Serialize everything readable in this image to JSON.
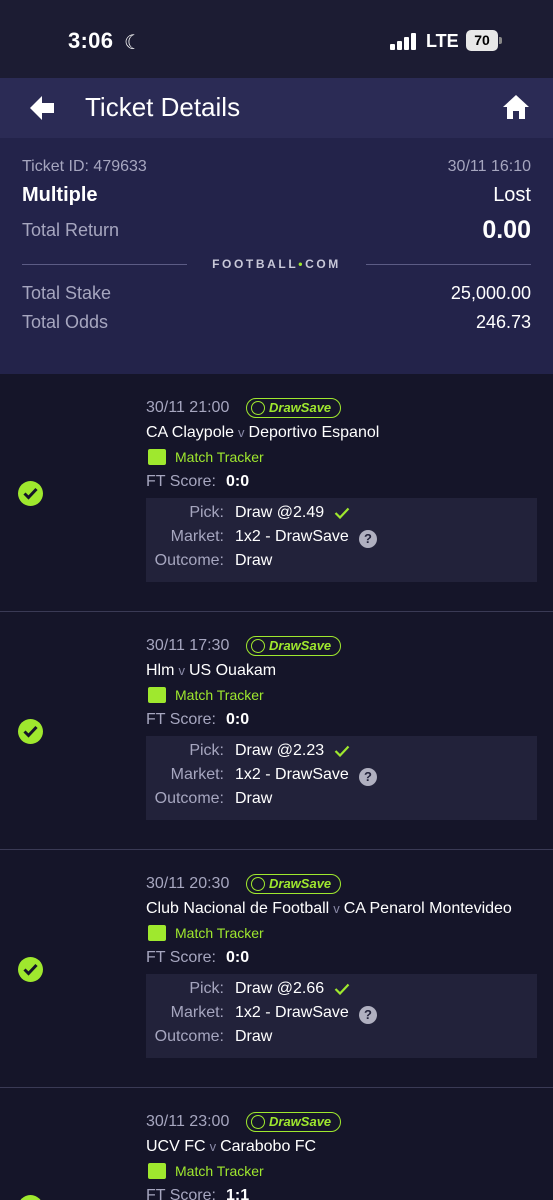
{
  "status_bar": {
    "time": "3:06",
    "network": "LTE",
    "battery": "70"
  },
  "header": {
    "title": "Ticket Details",
    "back_icon": "arrow-left-icon",
    "home_icon": "home-icon"
  },
  "summary": {
    "ticket_id": "Ticket ID: 479633",
    "date": "30/11 16:10",
    "bet_type": "Multiple",
    "status": "Lost",
    "total_return_label": "Total Return",
    "total_return": "0.00",
    "brand_left": "FOOTBALL",
    "brand_dot": "•",
    "brand_right": "COM",
    "total_stake_label": "Total Stake",
    "total_stake": "25,000.00",
    "total_odds_label": "Total Odds",
    "total_odds": "246.73"
  },
  "labels": {
    "drawsave": "DrawSave",
    "match_tracker": "Match Tracker",
    "ft_score": "FT Score:",
    "pick": "Pick:",
    "market": "Market:",
    "outcome": "Outcome:",
    "versus": "v",
    "help": "?"
  },
  "selections": [
    {
      "datetime": "30/11 21:00",
      "home": "CA Claypole",
      "away": "Deportivo Espanol",
      "ft_score": "0:0",
      "pick": "Draw @2.49",
      "market": "1x2 - DrawSave",
      "outcome": "Draw",
      "won": true
    },
    {
      "datetime": "30/11 17:30",
      "home": "Hlm",
      "away": "US Ouakam",
      "ft_score": "0:0",
      "pick": "Draw @2.23",
      "market": "1x2 - DrawSave",
      "outcome": "Draw",
      "won": true
    },
    {
      "datetime": "30/11 20:30",
      "home": "Club Nacional de Football",
      "away": "CA Penarol Montevideo",
      "ft_score": "0:0",
      "pick": "Draw @2.66",
      "market": "1x2 - DrawSave",
      "outcome": "Draw",
      "won": true
    },
    {
      "datetime": "30/11 23:00",
      "home": "UCV FC",
      "away": "Carabobo FC",
      "ft_score": "1:1",
      "pick": "",
      "market": "",
      "outcome": "",
      "won": true
    }
  ],
  "colors": {
    "accent": "#9fe82e",
    "background": "#151529",
    "header": "#2b2b55",
    "summary": "#23234a"
  }
}
